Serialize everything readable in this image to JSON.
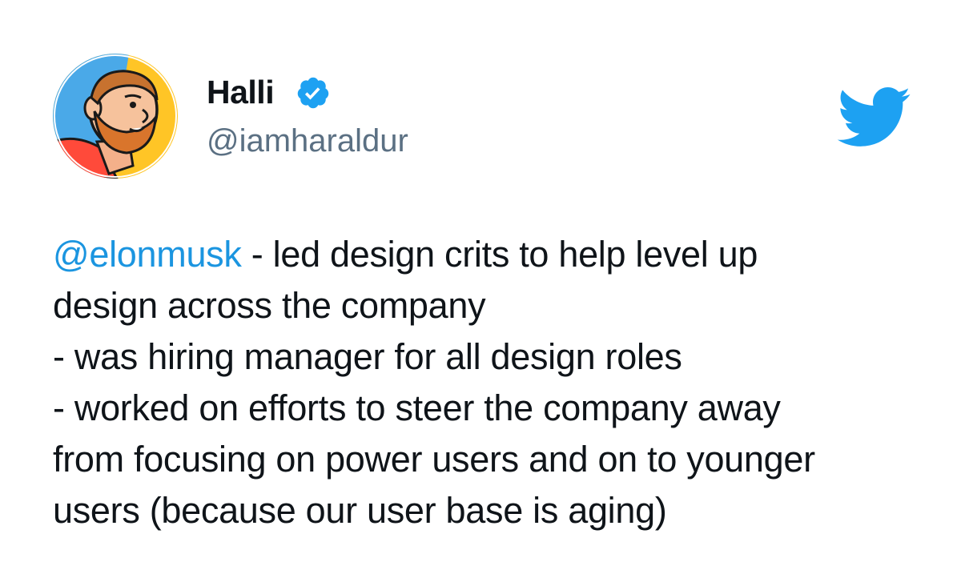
{
  "author": {
    "name": "Halli",
    "handle": "@iamharaldur",
    "avatar_icon": "cartoon-bearded-man-avatar",
    "verified_icon": "verified-badge-icon",
    "verified_color": "#1da1f2"
  },
  "brand": {
    "logo_icon": "twitter-bird-icon",
    "color": "#1da1f2"
  },
  "tweet": {
    "mention": "@elonmusk",
    "mention_color": "#1b95e0",
    "line1_rest": " - led design crits to help level up",
    "line2": "design across the company",
    "line3": "- was hiring manager for all design roles",
    "line4": "- worked on efforts to steer the company away",
    "line5": "from focusing on power users and on to younger",
    "line6": "users (because our user base is aging)"
  }
}
